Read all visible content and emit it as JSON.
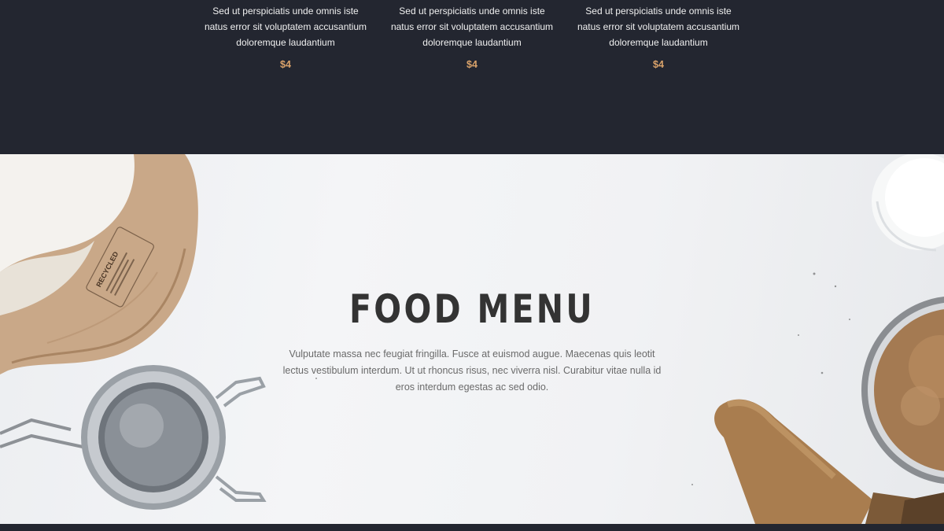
{
  "menu_items": [
    {
      "description": "Sed ut perspiciatis unde omnis iste natus error sit voluptatem accusantium doloremque laudantium",
      "price": "$4"
    },
    {
      "description": "Sed ut perspiciatis unde omnis iste natus error sit voluptatem accusantium doloremque laudantium",
      "price": "$4"
    },
    {
      "description": "Sed ut perspiciatis unde omnis iste natus error sit voluptatem accusantium doloremque laudantium",
      "price": "$4"
    }
  ],
  "banner": {
    "title": "FOOD MENU",
    "text": "Vulputate massa nec feugiat fringilla. Fusce at euismod augue. Maecenas quis leotit lectus vestibulum interdum. Ut ut rhoncus risus, nec viverra nisl. Curabitur vitae nulla id eros interdum egestas ac sed odio.",
    "flour_bag_print": "RECYCLED"
  },
  "colors": {
    "dark_background": "#232630",
    "price_accent": "#d9a26a",
    "title": "#333333"
  }
}
